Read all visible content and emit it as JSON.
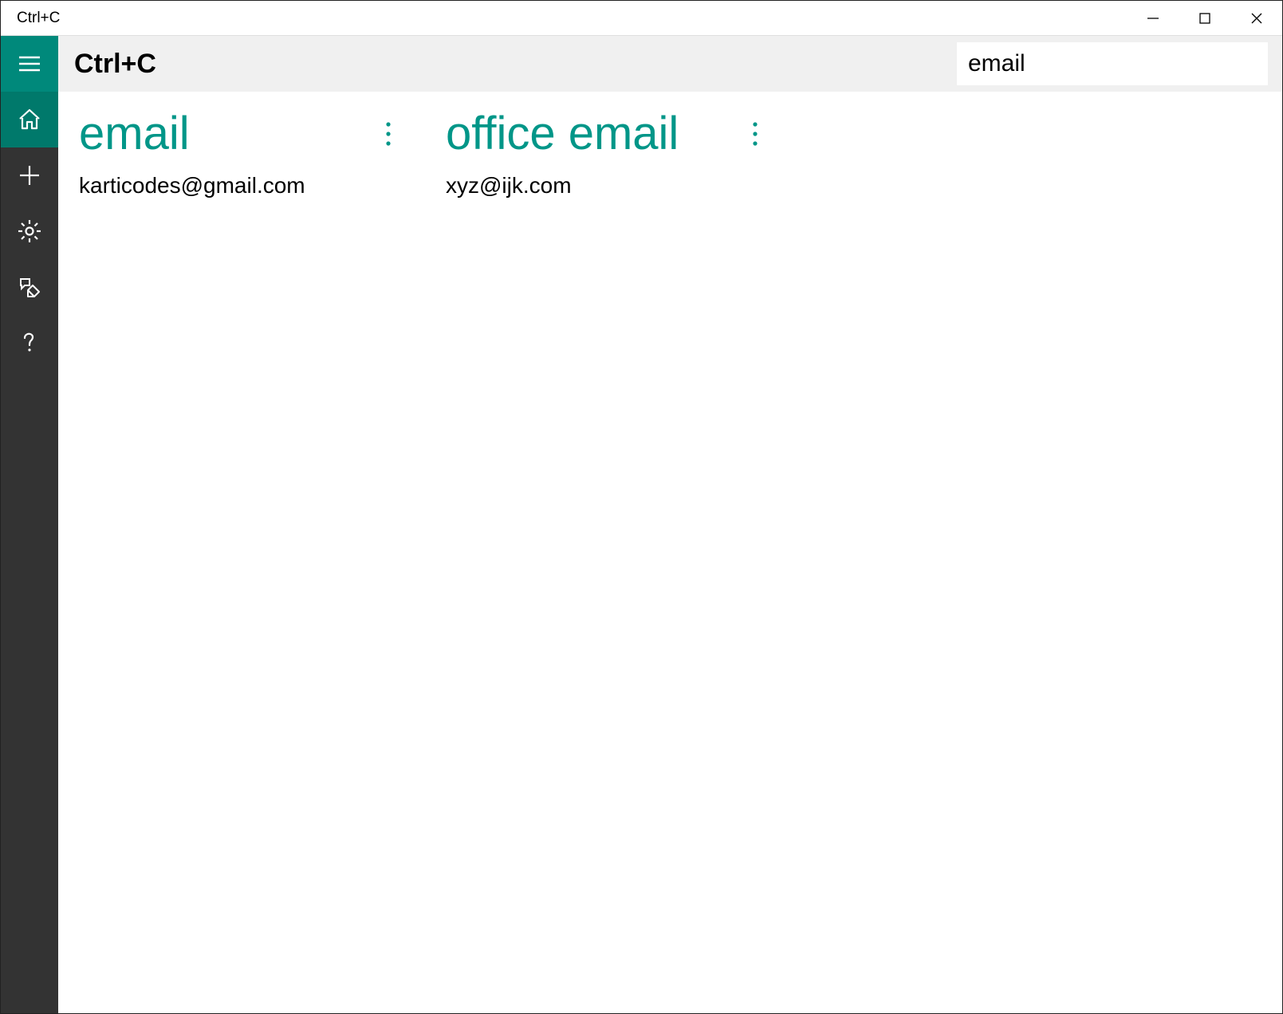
{
  "window": {
    "title": "Ctrl+C"
  },
  "topbar": {
    "page_title": "Ctrl+C"
  },
  "search": {
    "value": "email"
  },
  "cards": [
    {
      "title": "email",
      "detail": "karticodes@gmail.com"
    },
    {
      "title": "office email",
      "detail": "xyz@ijk.com"
    }
  ]
}
